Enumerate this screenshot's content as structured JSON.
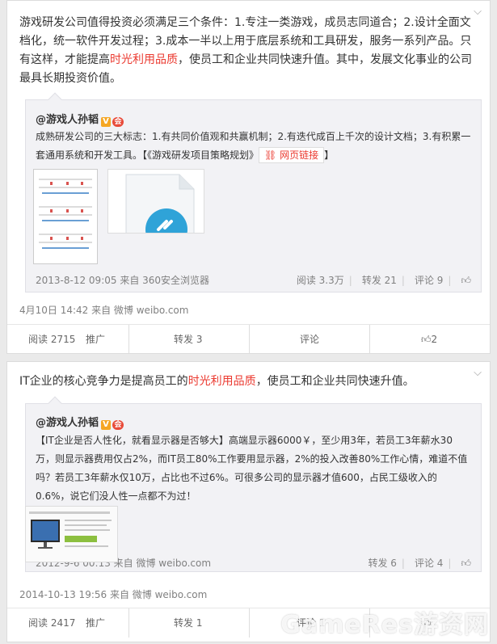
{
  "post1": {
    "text_a": "游戏研发公司值得投资必须满足三个条件：1.专注一类游戏，成员志同道合；2.设计全面文档化，统一软件开发过程；3.成本一半以上用于底层系统和工具研发，服务一系列产品。只有这样，才能提高",
    "text_red": "时光利用品质",
    "text_b": "，使员工和企业共同快速升值。其中，发展文化事业的公司最具长期投资价值。",
    "quote": {
      "author": "@游戏人孙韬",
      "text": "成熟研发公司的三大标志：1.有共同价值观和共赢机制；2.有迭代成百上千次的设计文档；3.有积累一套通用系统和开发工具。【《游戏研发项目策略规划》",
      "link_label": "网页链接",
      "text_end": "】",
      "meta": "2013-8-12 09:05 来自 360安全浏览器",
      "reads": "阅读 3.3万",
      "reposts": "转发 21",
      "comments": "评论 9"
    },
    "meta": "4月10日 14:42 来自 微博 weibo.com",
    "actions": {
      "reads": "阅读 2715",
      "promote": "推广",
      "repost": "转发 3",
      "comment": "评论",
      "likes": "2"
    }
  },
  "post2": {
    "text_a": "IT企业的核心竞争力是提高员工的",
    "text_red": "时光利用品质",
    "text_b": "，使员工和企业共同快速升值。",
    "quote": {
      "author": "@游戏人孙韬",
      "text": "【IT企业是否人性化，就看显示器是否够大】高端显示器6000￥，至少用3年，若员工3年薪水30万，则显示器费用仅占2%，而IT员工80%工作要用显示器，2%的投入改善80%工作心情，难道不值吗？若员工3年薪水仅10万，占比也不过6%。可很多公司的显示器才值600，占民工级收入的0.6%，说它们没人性一点都不为过！",
      "meta": "2012-9-6 00:13 来自 微博 weibo.com",
      "reposts": "转发 6",
      "comments": "评论 4"
    },
    "meta": "2014-10-13 19:56 来自 微博 weibo.com",
    "actions": {
      "reads": "阅读 2417",
      "promote": "推广",
      "repost": "转发 1",
      "comment": "评论 1"
    }
  },
  "watermark": "GameRes游资网"
}
